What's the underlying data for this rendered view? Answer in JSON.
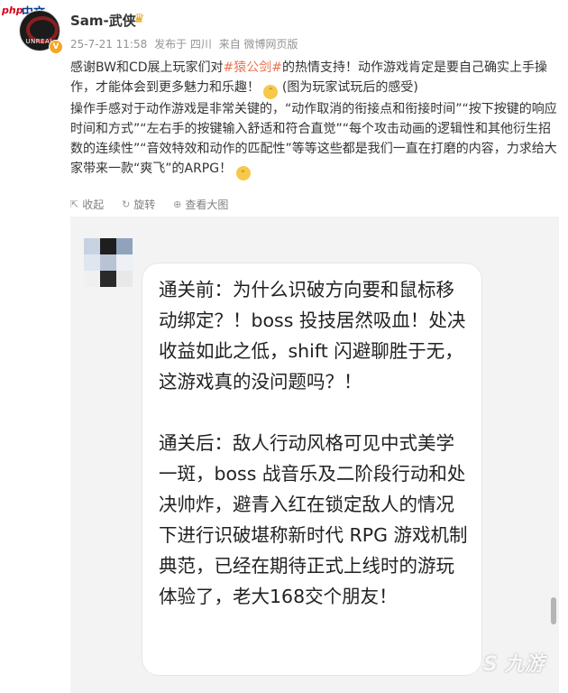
{
  "site_watermark": {
    "php": "php",
    "cn": "中文网"
  },
  "user": {
    "name": "Sam-武侠",
    "avatar_text": "UNREAL"
  },
  "meta": {
    "time": "25-7-21 11:58",
    "posted_from": "发布于 四川",
    "source": "来自 微博网页版"
  },
  "post": {
    "p1_a": "感谢BW和CD展上玩家们对",
    "p1_topic": "#猿公剑#",
    "p1_b": "的热情支持！动作游戏肯定是要自己确实上手操作，才能体会到更多魅力和乐趣！",
    "p1_c": " (图为玩家试玩后的感受)",
    "p2": "操作手感对于动作游戏是非常关键的，“动作取消的衔接点和衔接时间”“按下按键的响应时间和方式”“左右手的按键输入舒适和符合直觉”“每个攻击动画的逻辑性和其他衍生招数的连续性”“音效特效和动作的匹配性”等等这些都是我们一直在打磨的内容，力求给大家带来一款“爽飞”的ARPG！"
  },
  "actions": {
    "collect": "收起",
    "rotate": "旋转",
    "view_large": "查看大图"
  },
  "image": {
    "before": "通关前：为什么识破方向要和鼠标移动绑定？！boss 投技居然吸血！处决收益如此之低，shift 闪避聊胜于无，这游戏真的没问题吗？！",
    "after": "通关后：敌人行动风格可见中式美学一斑，boss 战音乐及二阶段行动和处决帅炸，避青入红在锁定敌人的情况下进行识破堪称新时代 RPG 游戏机制典范，已经在期待正式上线时的游玩体验了，老大168交个朋友！",
    "watermark": "九游"
  },
  "colors": {
    "topic": "#eb7350",
    "meta": "#939393",
    "bg_image": "#f3f3f4"
  }
}
